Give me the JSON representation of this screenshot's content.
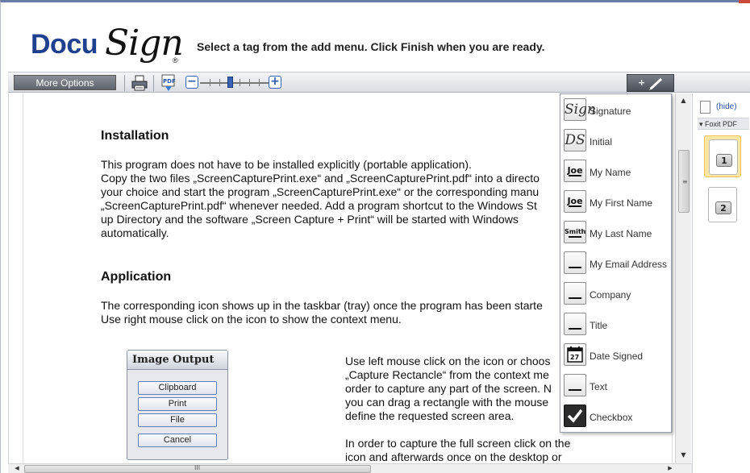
{
  "header": {
    "logo_docu": "Docu",
    "logo_sign": "Sign",
    "logo_reg": "®",
    "message": "Select a tag from the add menu. Click Finish when you are ready."
  },
  "toolbar": {
    "more_options_label": "More Options",
    "pdf_label": "PDF",
    "zoom_minus": "−",
    "zoom_plus": "+",
    "add_plus": "+"
  },
  "document": {
    "section1_heading": "Installation",
    "section1_body": "This program does not have to be installed explicitly (portable application).\nCopy the two files „ScreenCapturePrint.exe“ and „ScreenCapturePrint.pdf“ into a directo\nyour choice and start the program „ScreenCapturePrint.exe“ or the corresponding manu\n„ScreenCapturePrint.pdf“ whenever needed. Add a program shortcut to the Windows St\nup Directory and the software „Screen Capture + Print“ will be started with Windows\nautomatically.",
    "section2_heading": "Application",
    "section2_body": "The corresponding icon shows up in the taskbar (tray) once the program has been starte\nUse right mouse click on the icon to show the context menu.",
    "para3": "Use left mouse click on the icon or choos\n„Capture Rectancle“ from the context me\norder to capture any part of the screen. N\nyou can drag a rectangle with the mouse\ndefine the requested screen area.",
    "para4": "In order to capture the full screen click on the\nicon and afterwards once on the desktop or",
    "image_output": {
      "title": "Image Output",
      "buttons": [
        "Clipboard",
        "Print",
        "File",
        "Cancel"
      ]
    }
  },
  "tag_menu": {
    "items": [
      {
        "label": "Signature",
        "icon": "signature-icon",
        "glyph": "Sign"
      },
      {
        "label": "Initial",
        "icon": "initial-icon",
        "glyph": "DS"
      },
      {
        "label": "My Name",
        "icon": "name-icon",
        "glyph": "Joe"
      },
      {
        "label": "My First Name",
        "icon": "first-name-icon",
        "glyph": "Joe"
      },
      {
        "label": "My Last Name",
        "icon": "last-name-icon",
        "glyph": "Smith"
      },
      {
        "label": "My Email Address",
        "icon": "email-icon",
        "glyph": ""
      },
      {
        "label": "Company",
        "icon": "company-icon",
        "glyph": ""
      },
      {
        "label": "Title",
        "icon": "title-icon",
        "glyph": ""
      },
      {
        "label": "Date Signed",
        "icon": "calendar-icon",
        "glyph": "27"
      },
      {
        "label": "Text",
        "icon": "text-icon",
        "glyph": ""
      },
      {
        "label": "Checkbox",
        "icon": "checkbox-icon",
        "glyph": "✔"
      }
    ]
  },
  "side_panel": {
    "hide_label": "(hide)",
    "doc_title": "▾ Foxit PDF",
    "pages": [
      "1",
      "2"
    ],
    "active_page": "1"
  },
  "scrollbars": {
    "v_grip": "≡",
    "h_grip": "III"
  },
  "colors": {
    "brand_blue": "#1f3f8f",
    "toolbar_gray": "#5f636b",
    "active_thumb": "#fde5a2"
  }
}
